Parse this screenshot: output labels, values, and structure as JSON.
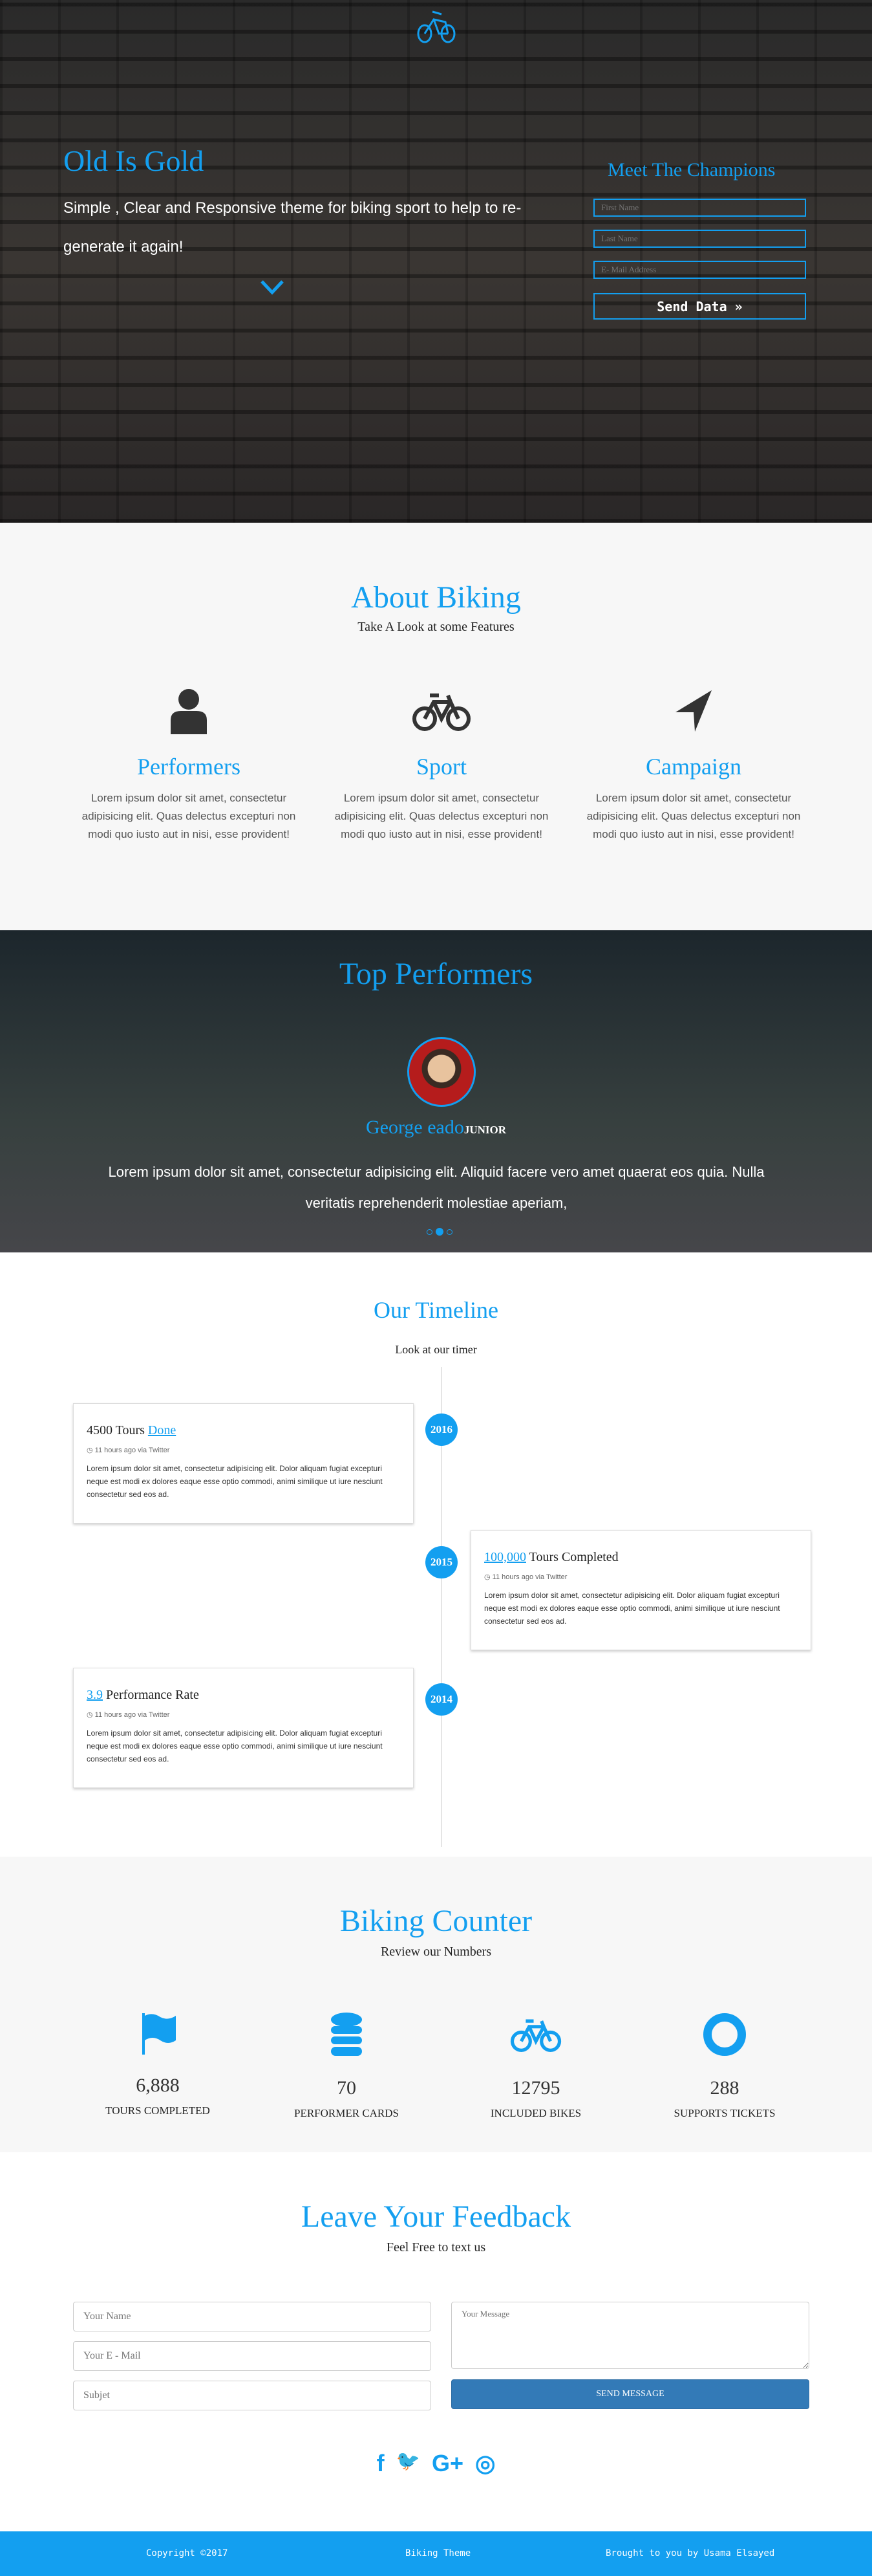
{
  "hero": {
    "logo": "bike-logo-icon",
    "title": "Old Is Gold",
    "subtitle": "Simple , Clear and Responsive theme for biking sport to help to re-generate it again!",
    "form_title": "Meet The Champions",
    "first_name_placeholder": "First Name",
    "last_name_placeholder": "Last Name",
    "email_placeholder": "E- Mail Address",
    "send_label": "Send Data »"
  },
  "about": {
    "title": "About Biking",
    "subtitle": "Take A Look at some Features",
    "features": [
      {
        "icon": "user-icon",
        "title": "Performers",
        "text": "Lorem ipsum dolor sit amet, consectetur adipisicing elit. Quas delectus excepturi non modi quo iusto aut in nisi, esse provident!"
      },
      {
        "icon": "bicycle-icon",
        "title": "Sport",
        "text": "Lorem ipsum dolor sit amet, consectetur adipisicing elit. Quas delectus excepturi non modi quo iusto aut in nisi, esse provident!"
      },
      {
        "icon": "location-arrow-icon",
        "title": "Campaign",
        "text": "Lorem ipsum dolor sit amet, consectetur adipisicing elit. Quas delectus excepturi non modi quo iusto aut in nisi, esse provident!"
      }
    ]
  },
  "performers": {
    "title": "Top Performers",
    "name": "George eado",
    "rank": "JUNIOR",
    "quote": "Lorem ipsum dolor sit amet, consectetur adipisicing elit. Aliquid facere vero amet quaerat eos quia. Nulla veritatis reprehenderit molestiae aperiam,",
    "active_slide": 2,
    "slide_count": 3
  },
  "timeline": {
    "title": "Our Timeline",
    "subtitle": "Look at our timer",
    "items": [
      {
        "year": "2016",
        "pre": "4500 Tours ",
        "link": "Done",
        "post": "",
        "meta": "11 hours ago via Twitter",
        "text": "Lorem ipsum dolor sit amet, consectetur adipisicing elit. Dolor aliquam fugiat excepturi neque est modi ex dolores eaque esse optio commodi, animi similique ut iure nesciunt consectetur sed eos ad."
      },
      {
        "year": "2015",
        "pre": "",
        "link": "100,000",
        "post": " Tours Completed",
        "meta": "11 hours ago via Twitter",
        "text": "Lorem ipsum dolor sit amet, consectetur adipisicing elit. Dolor aliquam fugiat excepturi neque est modi ex dolores eaque esse optio commodi, animi similique ut iure nesciunt consectetur sed eos ad."
      },
      {
        "year": "2014",
        "pre": "",
        "link": "3.9",
        "post": " Performance Rate",
        "meta": "11 hours ago via Twitter",
        "text": "Lorem ipsum dolor sit amet, consectetur adipisicing elit. Dolor aliquam fugiat excepturi neque est modi ex dolores eaque esse optio commodi, animi similique ut iure nesciunt consectetur sed eos ad."
      }
    ]
  },
  "counter": {
    "title": "Biking Counter",
    "subtitle": "Review our Numbers",
    "items": [
      {
        "icon": "flag-icon",
        "value": "6,888",
        "label": "TOURS COMPLETED"
      },
      {
        "icon": "database-icon",
        "value": "70",
        "label": "PERFORMER CARDS"
      },
      {
        "icon": "bicycle-icon",
        "value": "12795",
        "label": "INCLUDED BIKES"
      },
      {
        "icon": "life-ring-icon",
        "value": "288",
        "label": "SUPPORTS TICKETS"
      }
    ]
  },
  "feedback": {
    "title": "Leave Your Feedback",
    "subtitle": "Feel Free to text us",
    "name_placeholder": "Your Name",
    "email_placeholder": "Your E - Mail",
    "subject_placeholder": "Subjet",
    "message_placeholder": "Your Message",
    "send_label": "SEND MESSAGE",
    "social": [
      "facebook-icon",
      "twitter-icon",
      "google-plus-icon",
      "instagram-icon"
    ],
    "social_glyphs": [
      "f",
      "🐦",
      "G+",
      "◎"
    ]
  },
  "footer": {
    "copyright": "Copyright ©2017",
    "theme": "Biking Theme",
    "credit": "Brought to you by Usama Elsayed"
  },
  "colors": {
    "accent": "#139ff0",
    "button": "#337ab7"
  }
}
